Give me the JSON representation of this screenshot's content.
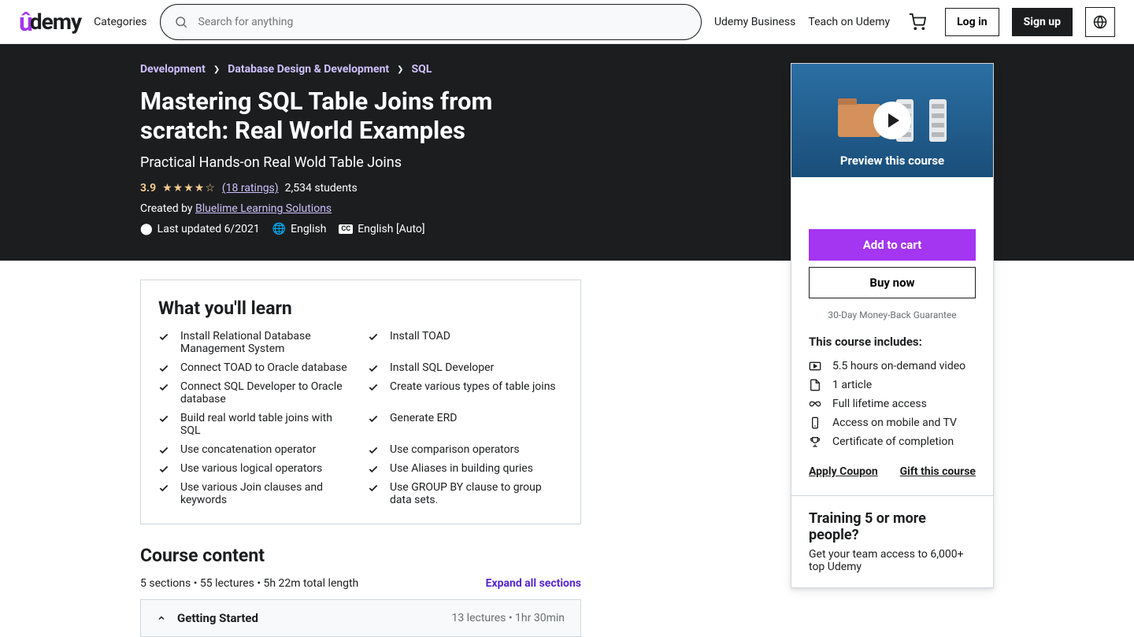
{
  "header": {
    "logo": "ûdemy",
    "categories": "Categories",
    "search_placeholder": "Search for anything",
    "business": "Udemy Business",
    "teach": "Teach on Udemy",
    "login": "Log in",
    "signup": "Sign up"
  },
  "breadcrumb": [
    {
      "label": "Development"
    },
    {
      "label": "Database Design & Development"
    },
    {
      "label": "SQL"
    }
  ],
  "course": {
    "title": "Mastering SQL Table Joins from scratch: Real World Examples",
    "subtitle": "Practical Hands-on Real Wold Table Joins",
    "rating": "3.9",
    "stars": "★★★★☆",
    "ratings_count": "(18 ratings)",
    "students": "2,534 students",
    "created_by_prefix": "Created by ",
    "author": "Bluelime Learning Solutions",
    "last_updated": "Last updated 6/2021",
    "language": "English",
    "captions": "English [Auto]"
  },
  "sidebar": {
    "preview_label": "Preview this course",
    "add_to_cart": "Add to cart",
    "buy_now": "Buy now",
    "guarantee": "30-Day Money-Back Guarantee",
    "includes_title": "This course includes:",
    "includes": [
      {
        "icon": "video",
        "text": "5.5 hours on-demand video"
      },
      {
        "icon": "file",
        "text": "1 article"
      },
      {
        "icon": "infinity",
        "text": "Full lifetime access"
      },
      {
        "icon": "mobile",
        "text": "Access on mobile and TV"
      },
      {
        "icon": "trophy",
        "text": "Certificate of completion"
      }
    ],
    "apply_coupon": "Apply Coupon",
    "gift": "Gift this course",
    "team_title": "Training 5 or more people?",
    "team_sub": "Get your team access to 6,000+ top Udemy"
  },
  "learn": {
    "title": "What you'll learn",
    "items": [
      "Install Relational Database Management System",
      "Install TOAD",
      "Connect TOAD to Oracle database",
      "Install SQL Developer",
      "Connect SQL Developer to Oracle database",
      "Create various types of table joins",
      "Build real world table joins with SQL",
      "Generate ERD",
      "Use concatenation operator",
      "Use comparison operators",
      "Use various logical operators",
      "Use Aliases in building quries",
      "Use various Join clauses and keywords",
      "Use GROUP BY clause to group data sets."
    ]
  },
  "content": {
    "title": "Course content",
    "summary": "5 sections • 55 lectures • 5h 22m total length",
    "expand": "Expand all sections",
    "first_section": {
      "title": "Getting Started",
      "meta": "13 lectures • 1hr 30min"
    }
  }
}
